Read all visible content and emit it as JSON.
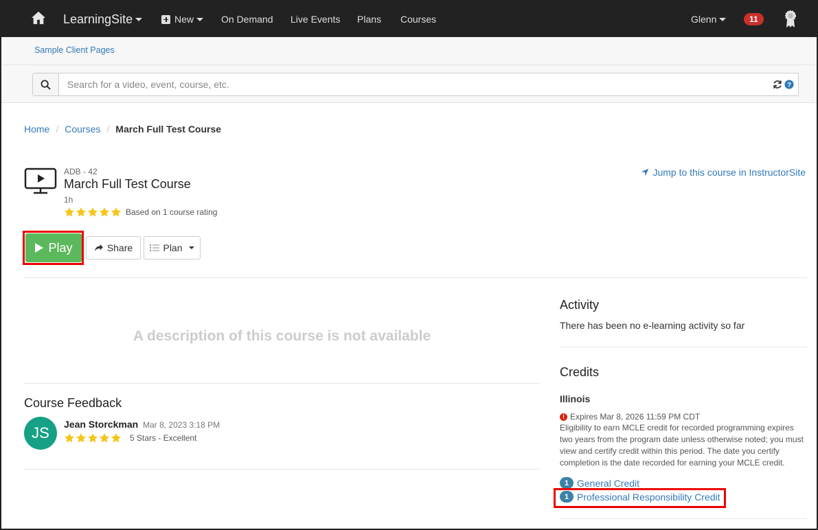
{
  "nav": {
    "brand": "LearningSite",
    "new_label": "New",
    "items": [
      "On Demand",
      "Live Events",
      "Plans",
      "Courses"
    ],
    "user": "Glenn",
    "notifications": "11"
  },
  "subbar": {
    "link": "Sample Client Pages",
    "search_placeholder": "Search for a video, event, course, etc."
  },
  "breadcrumb": {
    "home": "Home",
    "courses": "Courses",
    "current": "March Full Test Course"
  },
  "course": {
    "code": "ADB - 42",
    "title": "March Full Test Course",
    "duration": "1h",
    "rating_text": "Based on 1 course rating",
    "rating_stars": 5,
    "jump_link": "Jump to this course in InstructorSite"
  },
  "actions": {
    "play": "Play",
    "share": "Share",
    "plan": "Plan"
  },
  "description": {
    "empty_text": "A description of this course is not available"
  },
  "feedback": {
    "title": "Course Feedback",
    "entries": [
      {
        "initials": "JS",
        "name": "Jean Storckman",
        "date": "Mar 8, 2023 3:18 PM",
        "stars": 5,
        "rating_text": "5 Stars - Excellent"
      }
    ]
  },
  "activity": {
    "title": "Activity",
    "text": "There has been no e-learning activity so far"
  },
  "credits": {
    "title": "Credits",
    "state": "Illinois",
    "expires": "Expires Mar 8, 2026 11:59 PM CDT",
    "eligibility": "Eligibility to earn MCLE credit for recorded programming expires two years from the program date unless otherwise noted; you must view and certify credit within this period. The date you certify completion is the date recorded for earning your MCLE credit.",
    "items": [
      {
        "count": "1",
        "label": "General Credit"
      },
      {
        "count": "1",
        "label": "Professional Responsibility Credit"
      }
    ]
  },
  "colors": {
    "navbar": "#222222",
    "link": "#337ab7",
    "play": "#5cb85c",
    "badge": "#c9302c",
    "highlight": "#ee0000",
    "star": "#f5c518"
  }
}
